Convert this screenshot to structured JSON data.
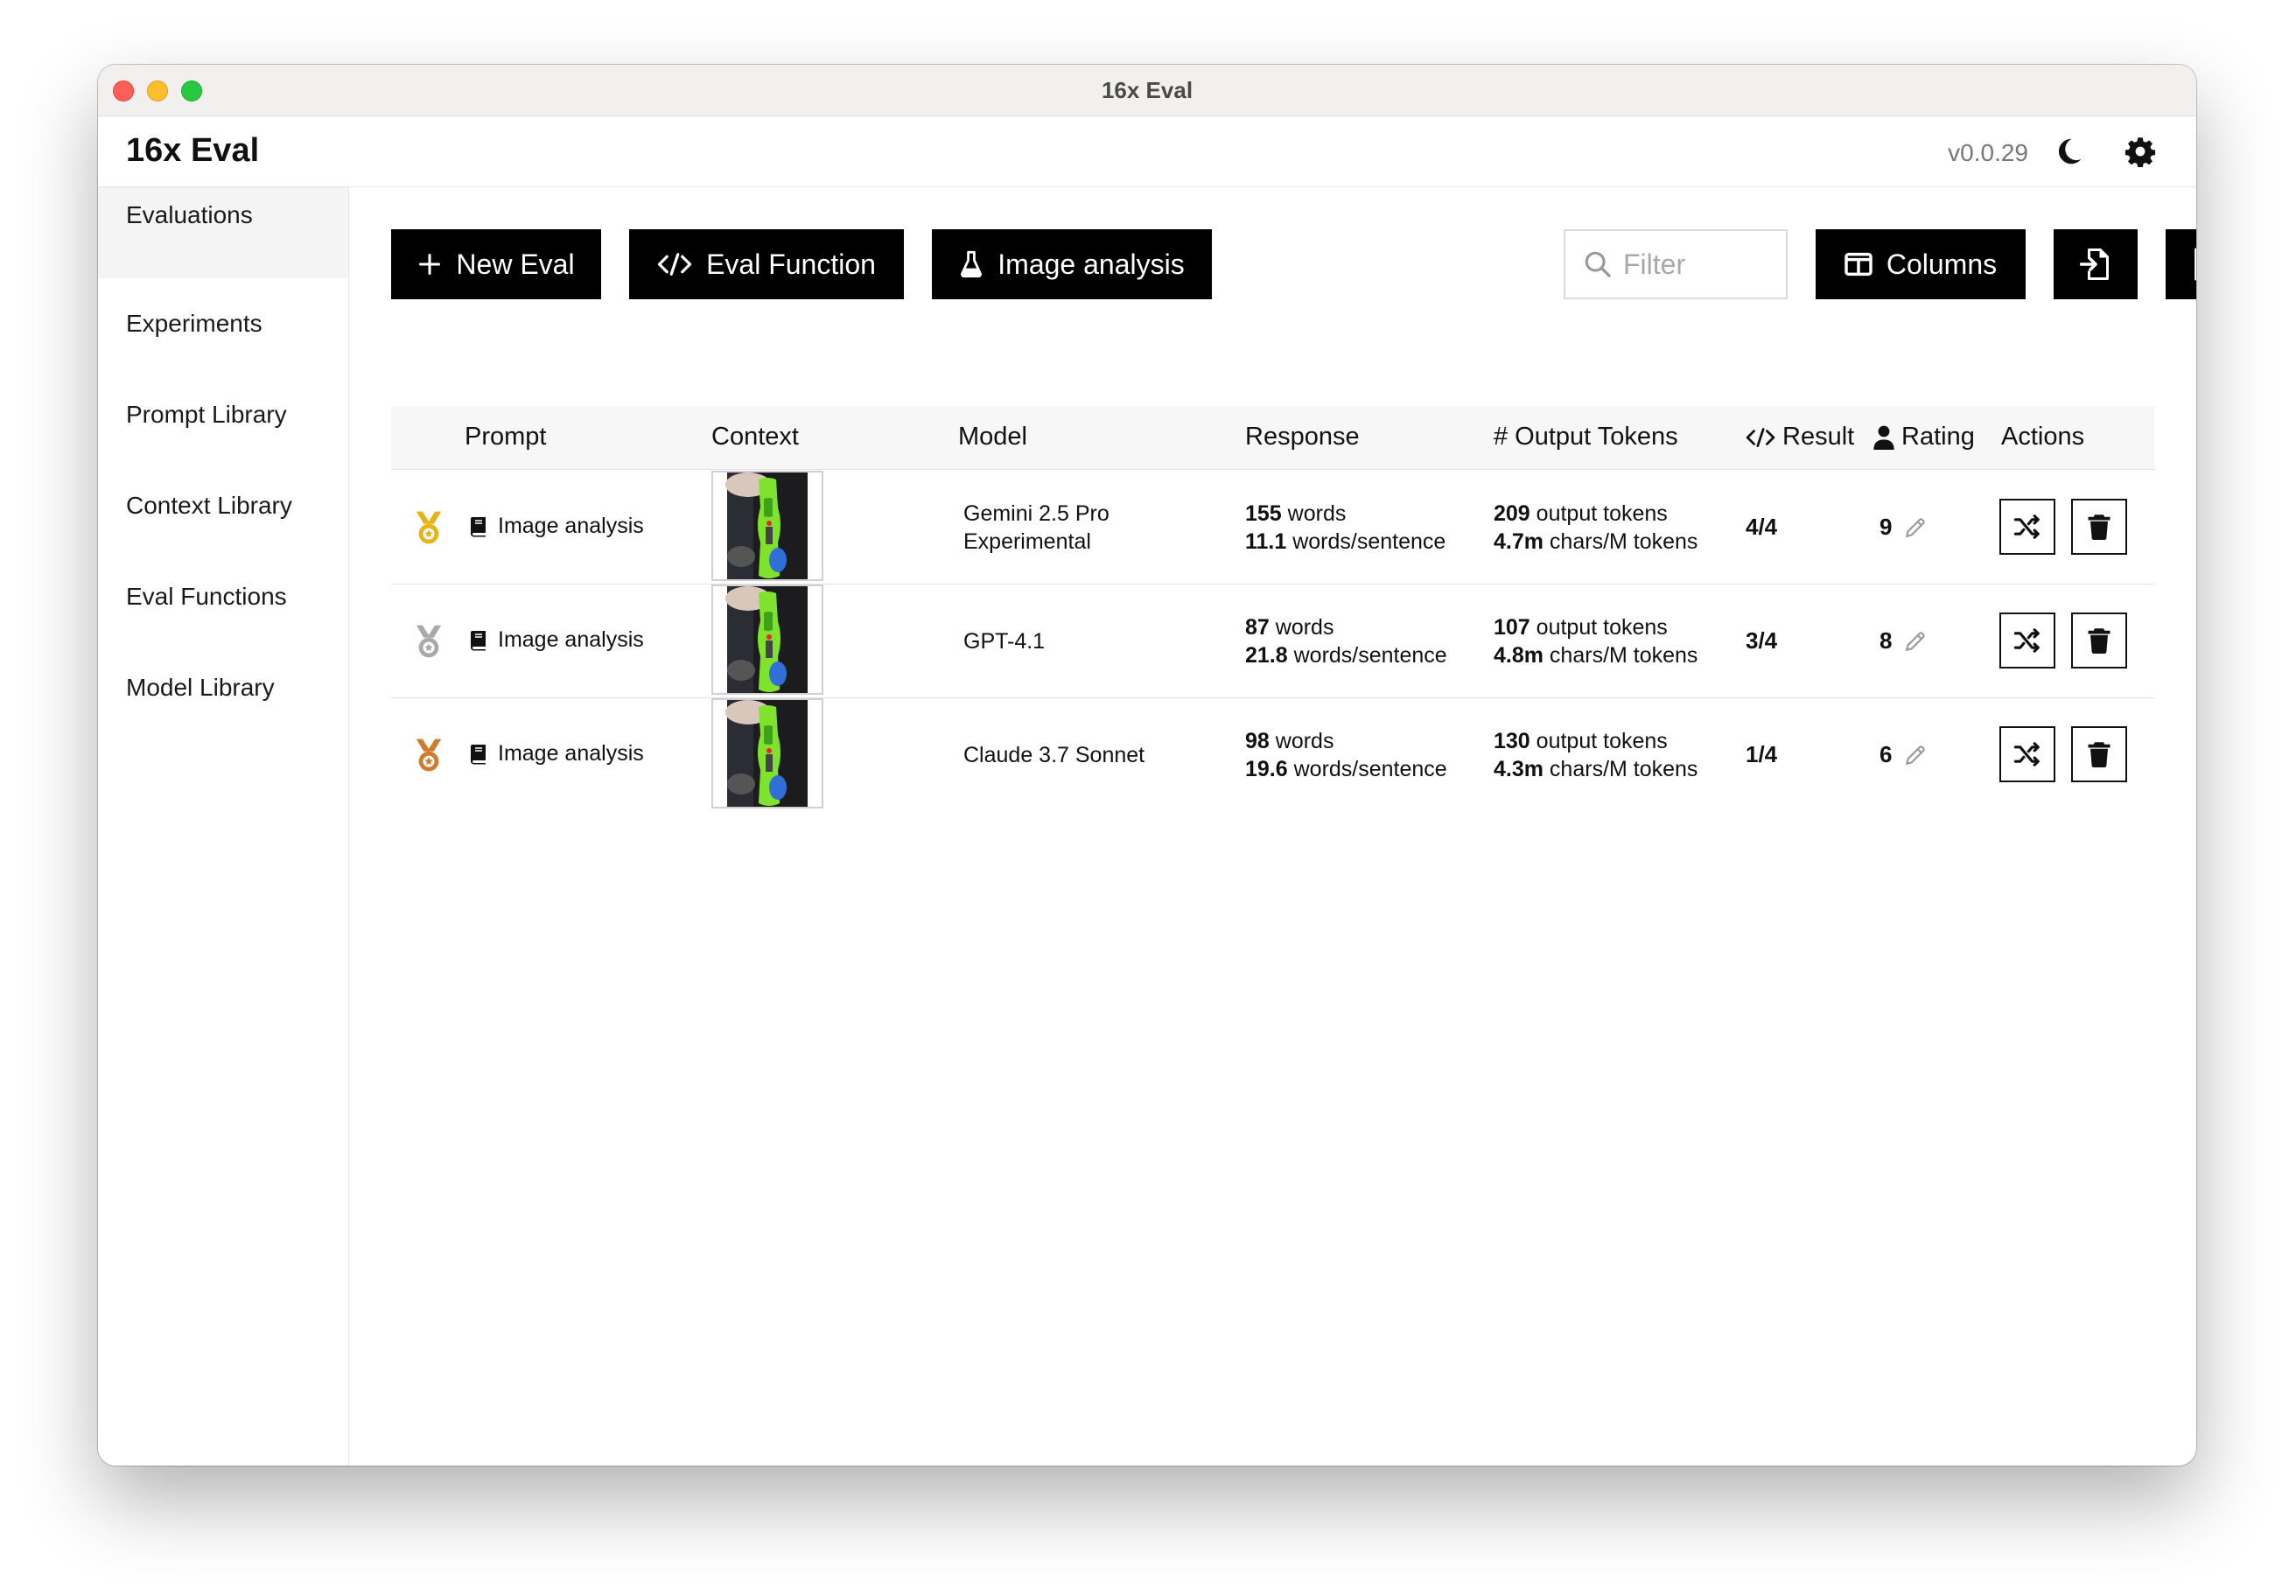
{
  "window": {
    "title": "16x Eval"
  },
  "header": {
    "app_title": "16x Eval",
    "version": "v0.0.29",
    "theme_icon": "moon-icon",
    "settings_icon": "gear-icon"
  },
  "sidebar": {
    "items": [
      {
        "label": "Evaluations",
        "active": true
      },
      {
        "label": "Experiments"
      },
      {
        "label": "Prompt Library"
      },
      {
        "label": "Context Library"
      },
      {
        "label": "Eval Functions"
      },
      {
        "label": "Model Library"
      }
    ]
  },
  "toolbar": {
    "new_eval_label": "New Eval",
    "eval_function_label": "Eval Function",
    "experiment_label": "Image analysis",
    "filter_placeholder": "Filter",
    "columns_label": "Columns",
    "import_icon": "file-import-icon",
    "export_icon": "file-export-icon"
  },
  "table": {
    "headers": {
      "prompt": "Prompt",
      "context": "Context",
      "model": "Model",
      "response": "Response",
      "output_tokens": "# Output Tokens",
      "result": "Result",
      "rating": "Rating",
      "actions": "Actions"
    },
    "rows": [
      {
        "medal": "gold-medal-icon",
        "medal_color": "#e7b416",
        "prompt": "Image analysis",
        "model_line1": "Gemini 2.5 Pro",
        "model_line2": "Experimental",
        "words": "155",
        "words_label": " words",
        "wps": "11.1",
        "wps_label": " words/sentence",
        "tokens": "209",
        "tokens_label": " output tokens",
        "cpt": "4.7m",
        "cpt_label": " chars/M tokens",
        "result": "4/4",
        "rating": "9"
      },
      {
        "medal": "silver-medal-icon",
        "medal_color": "#a9a9a9",
        "prompt": "Image analysis",
        "model_line1": "GPT-4.1",
        "model_line2": "",
        "words": "87",
        "words_label": " words",
        "wps": "21.8",
        "wps_label": " words/sentence",
        "tokens": "107",
        "tokens_label": " output tokens",
        "cpt": "4.8m",
        "cpt_label": " chars/M tokens",
        "result": "3/4",
        "rating": "8"
      },
      {
        "medal": "bronze-medal-icon",
        "medal_color": "#d27a2c",
        "prompt": "Image analysis",
        "model_line1": "Claude 3.7 Sonnet",
        "model_line2": "",
        "words": "98",
        "words_label": " words",
        "wps": "19.6",
        "wps_label": " words/sentence",
        "tokens": "130",
        "tokens_label": " output tokens",
        "cpt": "4.3m",
        "cpt_label": " chars/M tokens",
        "result": "1/4",
        "rating": "6"
      }
    ]
  }
}
